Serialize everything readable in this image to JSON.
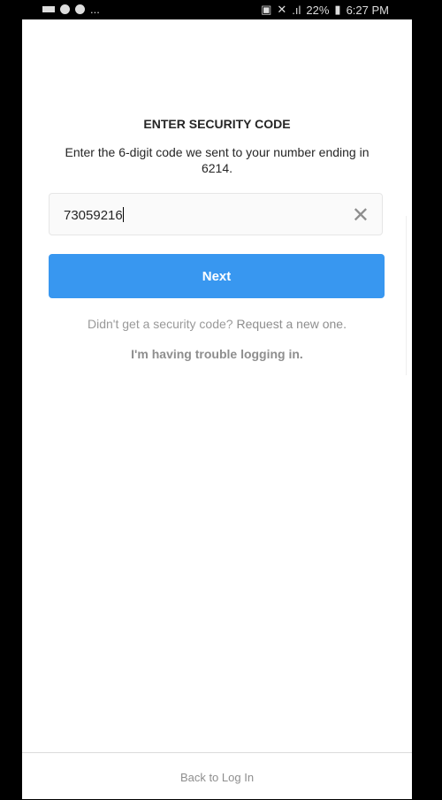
{
  "status_bar": {
    "battery": "22%",
    "time": "6:27 PM",
    "more": "..."
  },
  "page": {
    "title": "ENTER SECURITY CODE",
    "description": "Enter the 6-digit code we sent to your number ending in 6214.",
    "code_input": {
      "value": "73059216"
    },
    "next_label": "Next",
    "help_prefix": "Didn't get a security code?",
    "help_link": "Request a new one.",
    "trouble_link": "I'm having trouble logging in."
  },
  "footer": {
    "back_label": "Back to Log In"
  },
  "colors": {
    "accent": "#3897f0"
  }
}
